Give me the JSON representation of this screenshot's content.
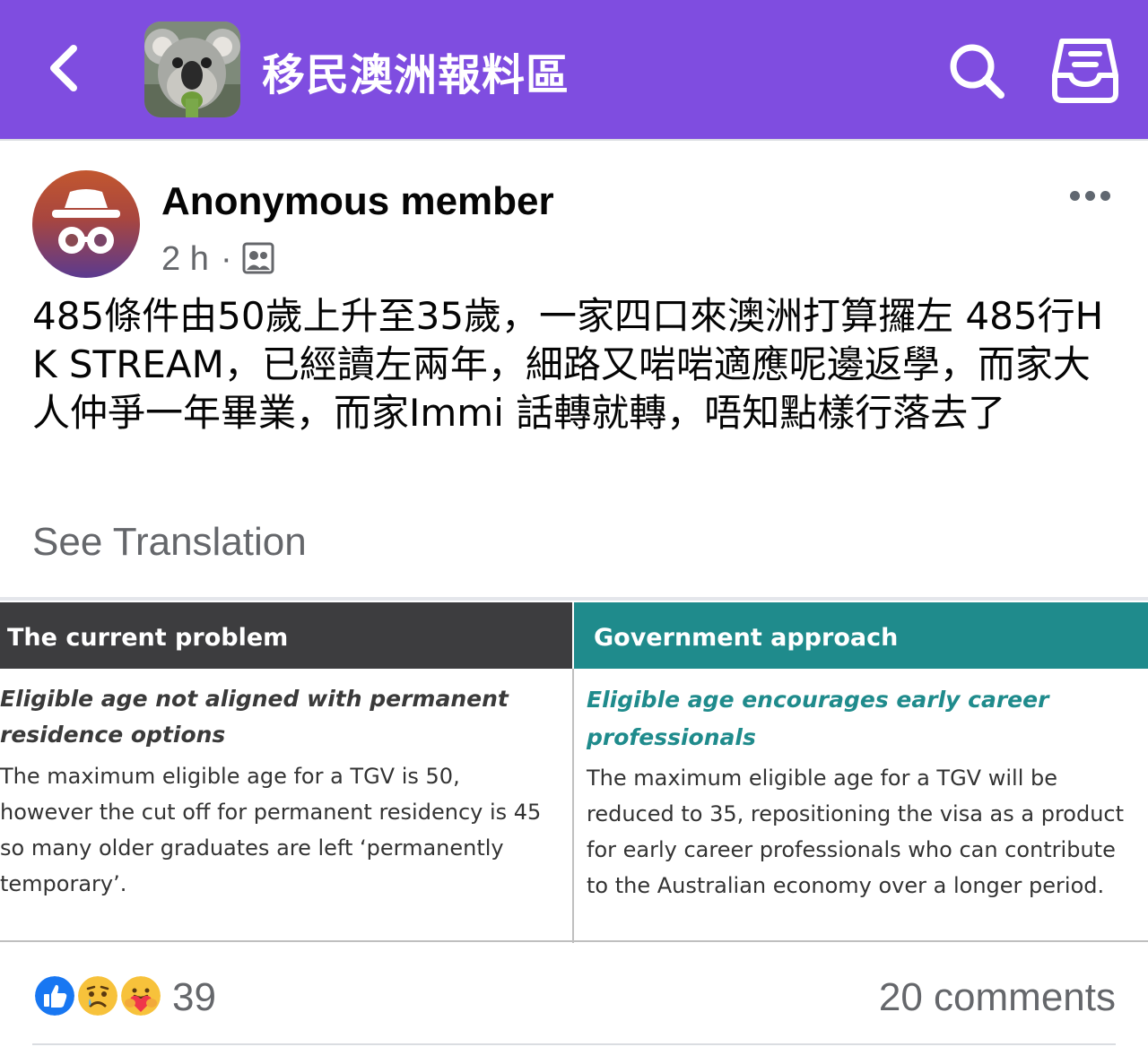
{
  "header": {
    "group_name": "移民澳洲報料區",
    "background_color": "#7f4de0",
    "icons": [
      "back-icon",
      "search-icon",
      "inbox-icon"
    ]
  },
  "post": {
    "author": "Anonymous member",
    "time": "2 h",
    "separator": "·",
    "privacy_icon": "group-members-icon",
    "text": "485條件由50歲上升至35歲，一家四口來澳洲打算攞左 485行HK STREAM，已經讀左兩年，細路又啱啱適應呢邊返學，而家大人仲爭一年畢業，而家Immi 話轉就轉，唔知點樣行落去了",
    "see_translation": "See Translation"
  },
  "image_table": {
    "left": {
      "header": "The current problem",
      "subheading": "Eligible age not aligned with permanent residence options",
      "body": "The maximum eligible age for a TGV is 50, however the cut off for permanent residency is 45 so many older graduates are left ‘permanently temporary’."
    },
    "right": {
      "header": "Government approach",
      "subheading": "Eligible age encourages early career professionals",
      "body": "The maximum eligible age for a TGV will be reduced to 35, repositioning the visa as a product for early career professionals who can contribute to the Australian economy over a longer period."
    },
    "colors": {
      "left_header": "#3d3d3f",
      "right_header": "#1f8b8c"
    }
  },
  "footer": {
    "reaction_icons": [
      "like-icon",
      "sad-icon",
      "care-icon"
    ],
    "reaction_count": "39",
    "comments": "20 comments"
  }
}
